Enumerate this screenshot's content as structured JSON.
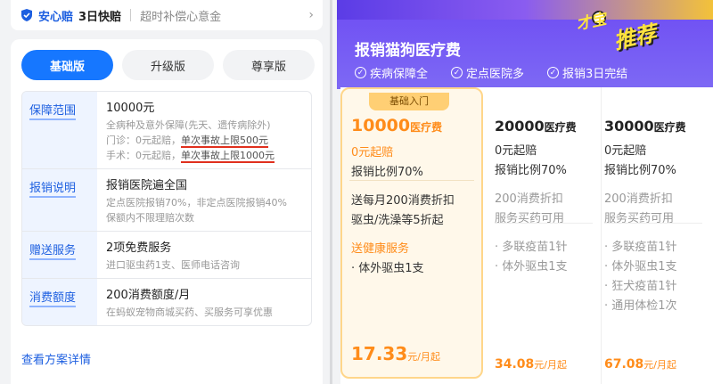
{
  "assurance": {
    "brand": "安心赔",
    "fast": "3日快赔",
    "slogan": "超时补偿心意金"
  },
  "tabs": [
    {
      "label": "基础版",
      "active": true
    },
    {
      "label": "升级版",
      "active": false
    },
    {
      "label": "尊享版",
      "active": false
    }
  ],
  "coverage": {
    "label": "保障范围",
    "title": "10000元",
    "line1": "全病种及意外保障(先天、遗传病除外)",
    "clinic_prefix": "门诊：0元起赔，",
    "clinic_limit": "单次事故上限500元",
    "surgery_prefix": "手术：0元起赔，",
    "surgery_limit": "单次事故上限1000元"
  },
  "reimburse": {
    "label": "报销说明",
    "title": "报销医院遍全国",
    "line1": "定点医院报销70%，非定点医院报销40%",
    "line2": "保额内不限理赔次数"
  },
  "gift": {
    "label": "赠送服务",
    "title": "2项免费服务",
    "line1": "进口驱虫药1支、医师电话咨询"
  },
  "quota": {
    "label": "消费额度",
    "title": "200消费额度/月",
    "line1": "在蚂蚁宠物商城买药、买服务可享优惠"
  },
  "plan_link": "查看方案详情",
  "hero": {
    "title": "报销猫狗医疗费",
    "features": [
      "疾病保障全",
      "定点医院多",
      "报销3日完结"
    ],
    "badge_1": "才宝",
    "badge_2": "推荐"
  },
  "plans": [
    {
      "tag": "基础入门",
      "amount": "10000",
      "amount_unit": "医疗费",
      "deductible": "0元起赔",
      "ratio": "报销比例70%",
      "extra1": "送每月200消费折扣",
      "extra2": "驱虫/洗澡等5折起",
      "gift_title": "送健康服务",
      "gifts": [
        "· 体外驱虫1支"
      ],
      "price": "17.33",
      "price_unit": "元/月起"
    },
    {
      "amount": "20000",
      "amount_unit": "医疗费",
      "deductible": "0元起赔",
      "ratio": "报销比例70%",
      "extra1": "200消费折扣",
      "extra2": "服务买药可用",
      "gifts": [
        "· 多联疫苗1针",
        "· 体外驱虫1支"
      ],
      "price": "34.08",
      "price_unit": "元/月起"
    },
    {
      "amount": "30000",
      "amount_unit": "医疗费",
      "deductible": "0元起赔",
      "ratio": "报销比例70%",
      "extra1": "200消费折扣",
      "extra2": "服务买药可用",
      "gifts": [
        "· 多联疫苗1针",
        "· 体外驱虫1支",
        "· 狂犬疫苗1针",
        "· 通用体检1次"
      ],
      "price": "67.08",
      "price_unit": "元/月起"
    }
  ]
}
